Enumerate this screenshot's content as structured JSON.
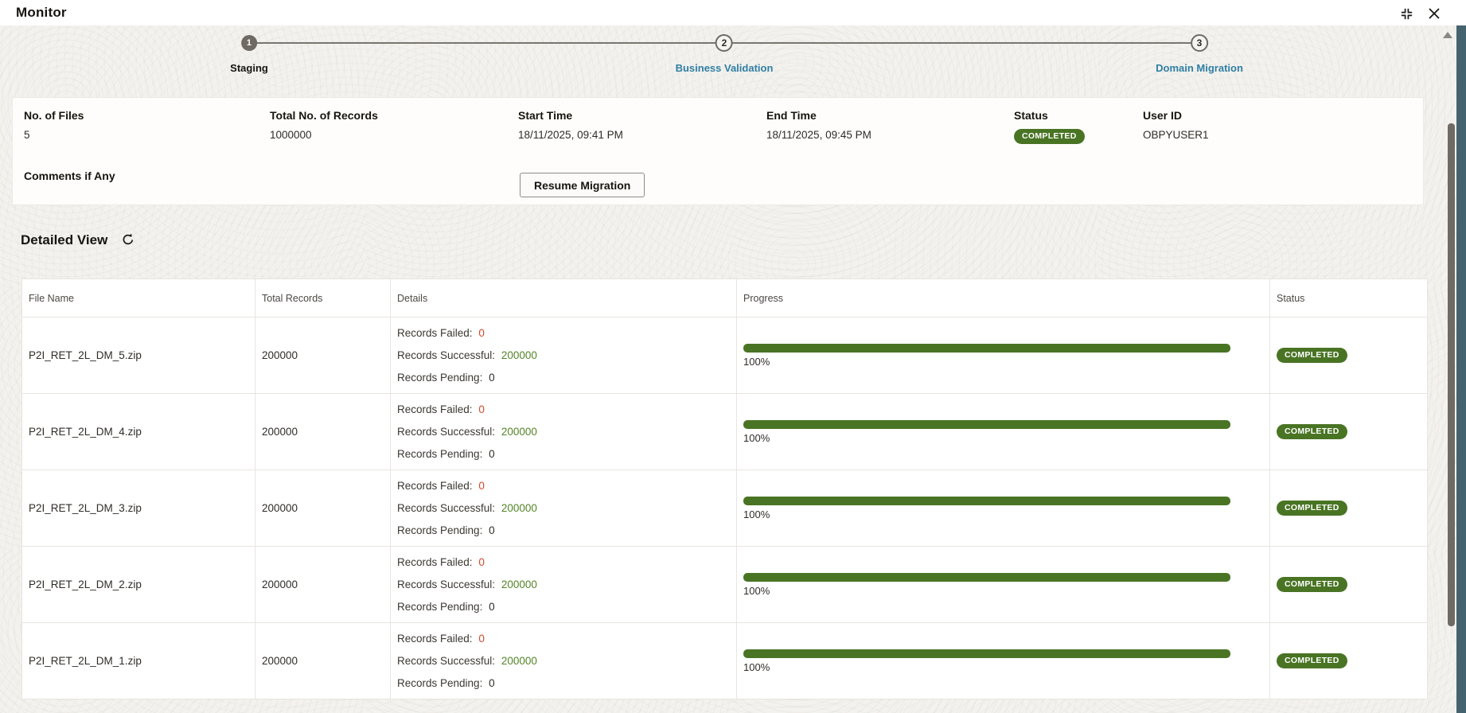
{
  "colors": {
    "green": "#497424",
    "success_green": "#538426",
    "failed_red": "#d0482b",
    "link_blue": "#2f7fa4",
    "teal_edge": "#45636e"
  },
  "window": {
    "title": "Monitor"
  },
  "stepper": {
    "steps": [
      {
        "number": "1",
        "label": "Staging",
        "state": "current"
      },
      {
        "number": "2",
        "label": "Business Validation",
        "state": "upcoming"
      },
      {
        "number": "3",
        "label": "Domain Migration",
        "state": "upcoming"
      }
    ]
  },
  "summary": {
    "fields": [
      {
        "label": "No. of Files",
        "value": "5"
      },
      {
        "label": "Total No. of Records",
        "value": "1000000"
      },
      {
        "label": "Start Time",
        "value": "18/11/2025, 09:41 PM"
      },
      {
        "label": "End Time",
        "value": "18/11/2025, 09:45 PM"
      },
      {
        "label": "Status",
        "value": "COMPLETED"
      },
      {
        "label": "User ID",
        "value": "OBPYUSER1"
      }
    ],
    "comments_label": "Comments if Any",
    "resume_button_label": "Resume Migration"
  },
  "detailed_view": {
    "heading": "Detailed View",
    "table": {
      "columns": [
        "File Name",
        "Total Records",
        "Details",
        "Progress",
        "Status"
      ],
      "detail_labels": {
        "failed": "Records Failed:",
        "successful": "Records Successful:",
        "pending": "Records Pending:"
      },
      "rows": [
        {
          "file_name": "P2I_RET_2L_DM_5.zip",
          "total_records": "200000",
          "records_failed": "0",
          "records_successful": "200000",
          "records_pending": "0",
          "progress_percent": 100,
          "progress_label": "100%",
          "status": "COMPLETED"
        },
        {
          "file_name": "P2I_RET_2L_DM_4.zip",
          "total_records": "200000",
          "records_failed": "0",
          "records_successful": "200000",
          "records_pending": "0",
          "progress_percent": 100,
          "progress_label": "100%",
          "status": "COMPLETED"
        },
        {
          "file_name": "P2I_RET_2L_DM_3.zip",
          "total_records": "200000",
          "records_failed": "0",
          "records_successful": "200000",
          "records_pending": "0",
          "progress_percent": 100,
          "progress_label": "100%",
          "status": "COMPLETED"
        },
        {
          "file_name": "P2I_RET_2L_DM_2.zip",
          "total_records": "200000",
          "records_failed": "0",
          "records_successful": "200000",
          "records_pending": "0",
          "progress_percent": 100,
          "progress_label": "100%",
          "status": "COMPLETED"
        },
        {
          "file_name": "P2I_RET_2L_DM_1.zip",
          "total_records": "200000",
          "records_failed": "0",
          "records_successful": "200000",
          "records_pending": "0",
          "progress_percent": 100,
          "progress_label": "100%",
          "status": "COMPLETED"
        }
      ]
    }
  }
}
